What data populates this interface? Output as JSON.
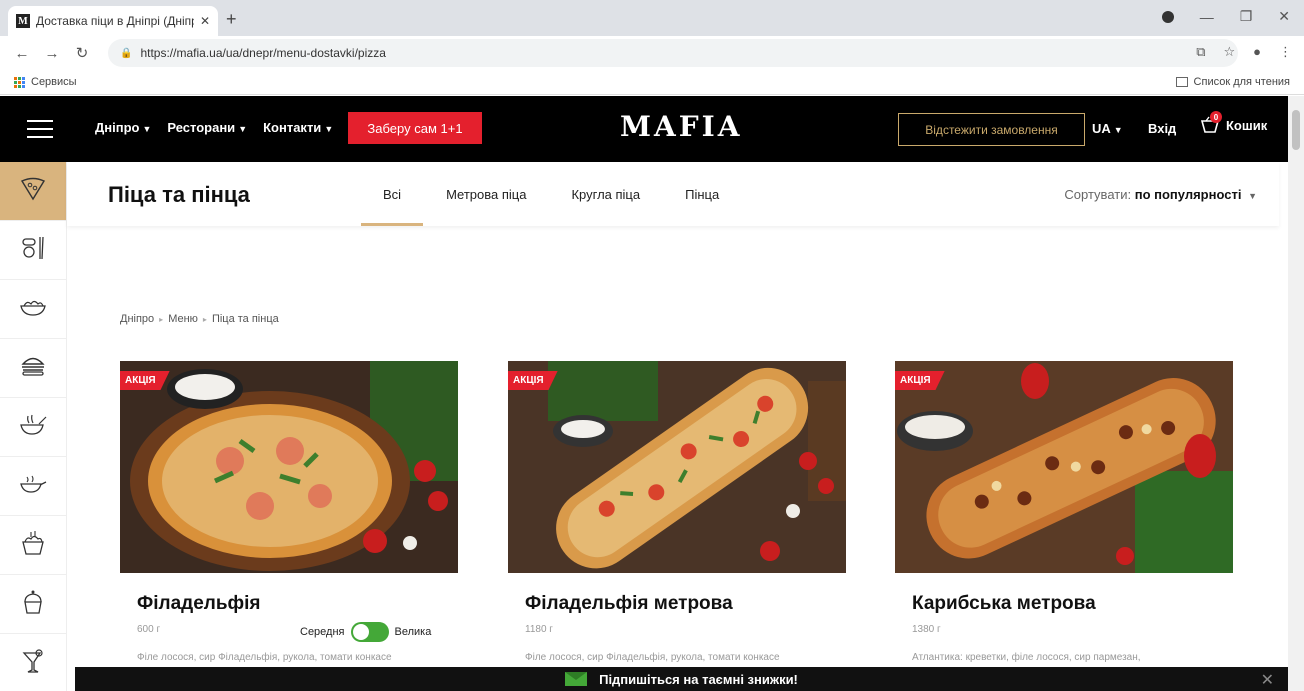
{
  "browser": {
    "tab_title": "Доставка піци в Дніпрі (Дніпро",
    "favicon": "M",
    "url": "https://mafia.ua/ua/dnepr/menu-dostavki/pizza",
    "bookmark": "Сервисы",
    "reading_list": "Список для чтения"
  },
  "header": {
    "nav": [
      "Дніпро",
      "Ресторани",
      "Контакти"
    ],
    "promo": "Заберу сам 1+1",
    "logo": "MAFIA",
    "track": "Відстежити замовлення",
    "lang": "UA",
    "login": "Вхід",
    "cart": "Кошик",
    "cart_count": "0"
  },
  "sidebar": {
    "icons": [
      "pizza-icon",
      "sushi-icon",
      "salad-icon",
      "burger-icon",
      "noodles-icon",
      "wok-icon",
      "bowl-icon",
      "cupcake-icon",
      "drink-icon"
    ]
  },
  "subheader": {
    "title": "Піца та пінца",
    "tabs": [
      "Всі",
      "Метрова піца",
      "Кругла піца",
      "Пінца"
    ],
    "sort_label": "Сортувати:",
    "sort_value": "по популярності"
  },
  "breadcrumb": [
    "Дніпро",
    "Меню",
    "Піца та пінца"
  ],
  "products": [
    {
      "badge": "АКЦІЯ",
      "name": "Філадельфія",
      "weight": "600 г",
      "desc": "Філе лосося, сир Філадельфія, рукола, томати конкасе",
      "size_left": "Середня",
      "size_right": "Велика"
    },
    {
      "badge": "АКЦІЯ",
      "name": "Філадельфія метрова",
      "weight": "1180 г",
      "desc": "Філе лосося, сир Філадельфія, рукола, томати конкасе"
    },
    {
      "badge": "АКЦІЯ",
      "name": "Карибська метрова",
      "weight": "1380 г",
      "desc": "Атлантика: креветки, філе лосося, сир пармезан,"
    }
  ],
  "newsletter": {
    "text": "Підпишіться на таємні знижки!"
  },
  "colors": {
    "accent": "#d9b47e",
    "promo": "#e4202d",
    "toggle": "#44a838"
  }
}
